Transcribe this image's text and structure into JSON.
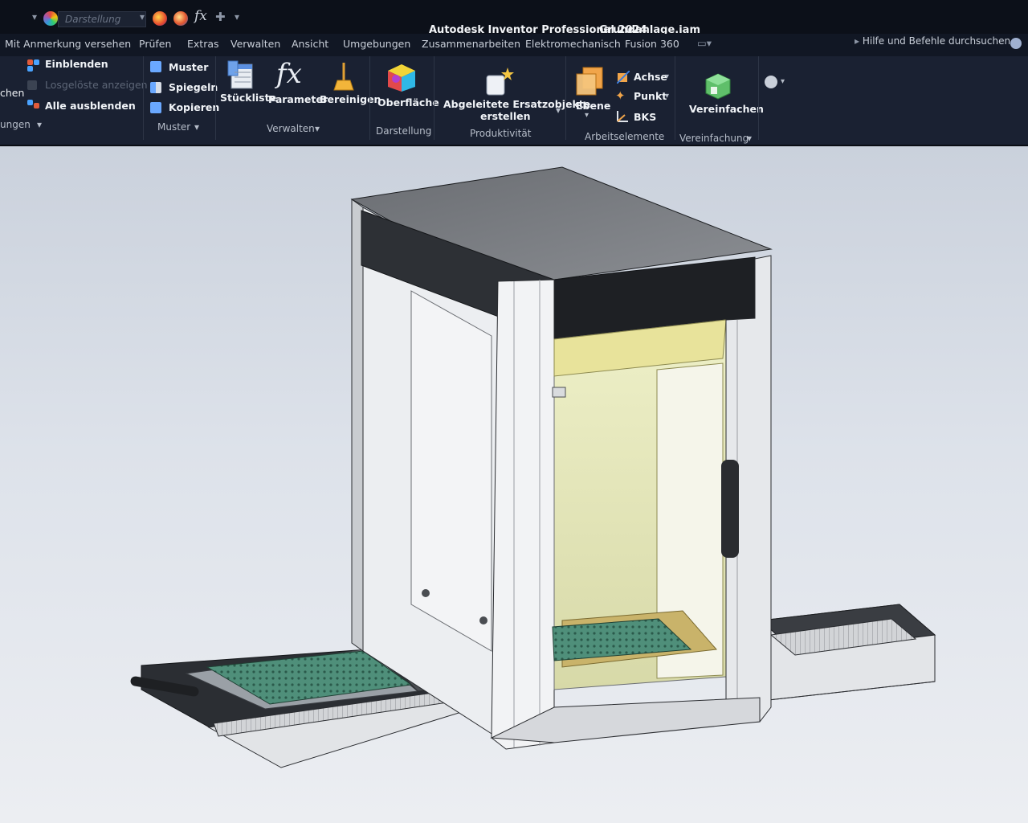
{
  "qat": {
    "appearance_combo": "Darstellung",
    "app_title": "Autodesk Inventor Professional 2024",
    "doc_title": "Grundanlage.iam"
  },
  "menu": [
    "Mit Anmerkung versehen",
    "Prüfen",
    "Extras",
    "Verwalten",
    "Ansicht",
    "Umgebungen",
    "Zusammenarbeiten",
    "Elektromechanisch",
    "Fusion 360"
  ],
  "help_search": "Hilfe und Befehle durchsuchen..",
  "ribbon": {
    "left_cut_label": "chen",
    "left_group_cut": "ungen",
    "einblenden": "Einblenden",
    "losgeloeste": "Losgelöste anzeigen",
    "alle_ausblenden": "Alle ausblenden",
    "muster": "Muster",
    "spiegeln": "Spiegeln",
    "kopieren": "Kopieren",
    "muster_group": "Muster",
    "stueckliste": "Stückliste",
    "parameter": "Parameter",
    "bereinigen": "Bereinigen",
    "verwalten_group": "Verwalten",
    "oberflaeche": "Oberfläche",
    "darstellung_group": "Darstellung",
    "ersatz_line1": "Abgeleitete Ersatzobjekte",
    "ersatz_line2": "erstellen",
    "produktivitaet_group": "Produktivität",
    "ebene": "Ebene",
    "achse": "Achse",
    "punkt": "Punkt",
    "bks": "BKS",
    "arbeitselemente_group": "Arbeitselemente",
    "vereinfachen": "Vereinfachen",
    "vereinfachung_group": "Vereinfachung"
  },
  "colors": {
    "qat_bg": "#0c1019",
    "ribbon_bg": "#1a2132",
    "viewport_top": "#cad1dc",
    "viewport_bottom": "#eceef2"
  }
}
